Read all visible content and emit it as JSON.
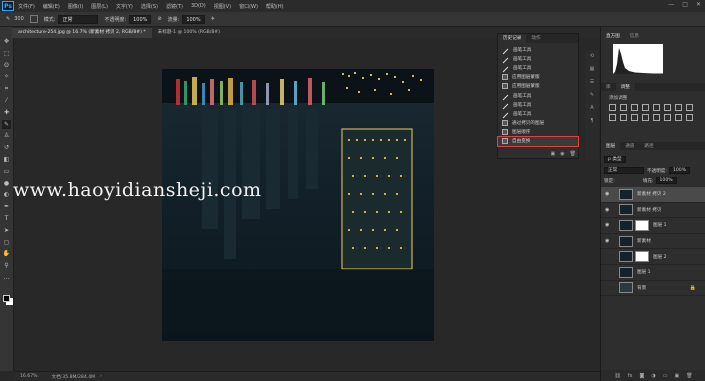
{
  "menu": [
    "文件(F)",
    "编辑(E)",
    "图像(I)",
    "图层(L)",
    "文字(Y)",
    "选择(S)",
    "滤镜(T)",
    "3D(D)",
    "视图(V)",
    "窗口(W)",
    "帮助(H)"
  ],
  "window_controls": [
    "—",
    "□",
    "✕"
  ],
  "options": {
    "size": "300",
    "mode_label": "模式:",
    "mode_value": "正常",
    "opacity_label": "不透明度:",
    "opacity_value": "100%",
    "flow_label": "流量:",
    "flow_value": "100%"
  },
  "tabs": [
    "architecture-254.jpg @ 16.7% (新素材 拷贝 2, RGB/8#) *",
    "未标题-1 @ 100% (RGB/8#)"
  ],
  "status": {
    "zoom": "16.67%",
    "doc": "文档:35.8M/284.4M"
  },
  "watermark": "www.haoyidiansheji.com",
  "history": {
    "tabs": [
      "历史记录",
      "动作"
    ],
    "items": [
      {
        "label": "画笔工具",
        "icon": "brush"
      },
      {
        "label": "画笔工具",
        "icon": "brush"
      },
      {
        "label": "画笔工具",
        "icon": "brush"
      },
      {
        "label": "应用图层蒙版",
        "icon": "doc"
      },
      {
        "label": "应用图层蒙版",
        "icon": "doc"
      },
      {
        "label": "画笔工具",
        "icon": "brush"
      },
      {
        "label": "画笔工具",
        "icon": "brush"
      },
      {
        "label": "画笔工具",
        "icon": "brush"
      },
      {
        "label": "通过拷贝的图层",
        "icon": "doc"
      },
      {
        "label": "图层顺序",
        "icon": "doc"
      },
      {
        "label": "自由变换",
        "icon": "doc",
        "selected": true
      }
    ]
  },
  "right_panel": {
    "top_tabs": [
      "直方图",
      "信息"
    ],
    "adjust_tabs": [
      "库",
      "调整"
    ],
    "adjust_label": "添加调整",
    "layer_tabs": [
      "图层",
      "通道",
      "路径"
    ],
    "filter_label": "p 类型",
    "blend_mode": "正常",
    "opacity_label": "不透明度:",
    "opacity_value": "100%",
    "lock_label": "锁定:",
    "fill_label": "填充:",
    "fill_value": "100%"
  },
  "layers": [
    {
      "name": "新素材 拷贝 2",
      "visible": true,
      "selected": true,
      "mask": false
    },
    {
      "name": "新素材 拷贝",
      "visible": true,
      "selected": false,
      "mask": false
    },
    {
      "name": "图层 1",
      "visible": true,
      "selected": false,
      "mask": true
    },
    {
      "name": "新素材",
      "visible": true,
      "selected": false,
      "mask": false
    },
    {
      "name": "图层 2",
      "visible": false,
      "selected": false,
      "mask": true
    },
    {
      "name": "图层 1",
      "visible": false,
      "selected": false,
      "mask": false
    },
    {
      "name": "背景",
      "visible": false,
      "selected": false,
      "mask": false
    }
  ]
}
